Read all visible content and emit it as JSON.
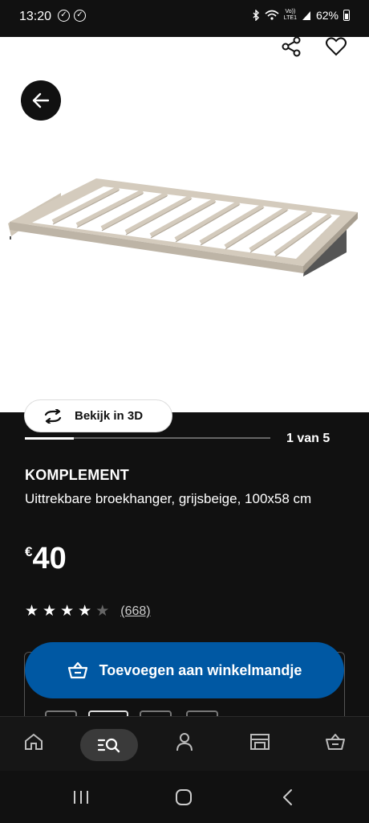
{
  "status_bar": {
    "time": "13:20",
    "check_glyph": "✓",
    "network_top": "Vo))",
    "network_bottom": "LTE1",
    "battery": "62%"
  },
  "hero": {
    "back_icon": "arrow-left-icon",
    "share_icon": "share-icon",
    "favorite_icon": "heart-icon",
    "view_3d_label": "Bekijk in 3D"
  },
  "gallery": {
    "progress": 0.2,
    "position_label": "1 van 5"
  },
  "product": {
    "name": "KOMPLEMENT",
    "description": "Uittrekbare broekhanger, grijsbeige, 100x58 cm",
    "price_currency": "€",
    "price_value": "40",
    "rating": 4,
    "rating_max": 5,
    "reviews": "(668)"
  },
  "cart": {
    "add_label": "Toevoegen aan winkelmandje",
    "button_color": "#0058a3"
  },
  "bottom_nav": [
    {
      "name": "home",
      "icon": "home-icon"
    },
    {
      "name": "search",
      "icon": "search-icon"
    },
    {
      "name": "profile",
      "icon": "person-icon"
    },
    {
      "name": "store",
      "icon": "store-icon"
    },
    {
      "name": "basket",
      "icon": "basket-icon"
    }
  ],
  "colors": {
    "background": "#111111",
    "accent": "#0058a3",
    "product_beige": "#d4cbbd"
  }
}
